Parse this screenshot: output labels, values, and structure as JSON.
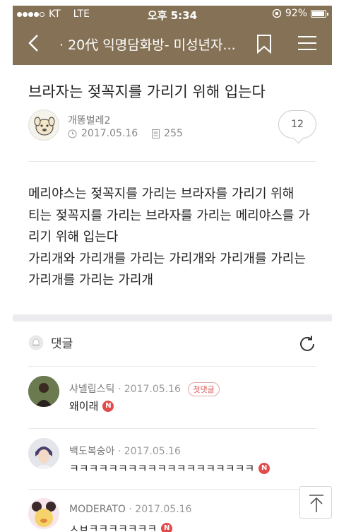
{
  "status": {
    "carrier": "KT",
    "network": "LTE",
    "time": "오후 5:34",
    "battery": "92%"
  },
  "nav": {
    "title": "· 20代 익명담화방- 미성년자...",
    "back_icon": "chevron-left-icon",
    "bookmark_icon": "bookmark-icon",
    "menu_icon": "hamburger-menu-icon"
  },
  "post": {
    "title": "브라자는 젖꼭지를 가리기 위해 입는다",
    "author": "개똥벌레2",
    "date": "2017.05.16",
    "views": "255",
    "comment_count": "12",
    "body": [
      "메리야스는 젖꼭지를 가리는 브라자를 가리기 위해",
      "티는 젖꼭지를 가리는 브라자를 가리는 메리야스를 가",
      "리기 위해 입는다",
      "가리개와 가리개를 가리는 가리개와 가리개를 가리는",
      "가리개를 가리는 가리개"
    ]
  },
  "comments_section": {
    "label": "댓글"
  },
  "comments": [
    {
      "name": "샤넬립스틱",
      "date": "· 2017.05.16",
      "badge": "첫댓글",
      "text": "왜이래",
      "new": "N"
    },
    {
      "name": "백도복숭아",
      "date": "· 2017.05.16",
      "badge": "",
      "text": "ㅋㅋㅋㅋㅋㅋㅋㅋㅋㅋㅋㅋㅋㅋㅋㅋㅋㅋㅋ",
      "new": "N"
    },
    {
      "name": "MODERATO",
      "date": "· 2017.05.16",
      "badge": "",
      "text": "ㅅㅂㅋㅋㅋㅋㅋㅋㅋ",
      "new": "N"
    }
  ],
  "colors": {
    "brand": "#857256",
    "divider": "#ececf0",
    "new_badge": "#e34b4b"
  }
}
